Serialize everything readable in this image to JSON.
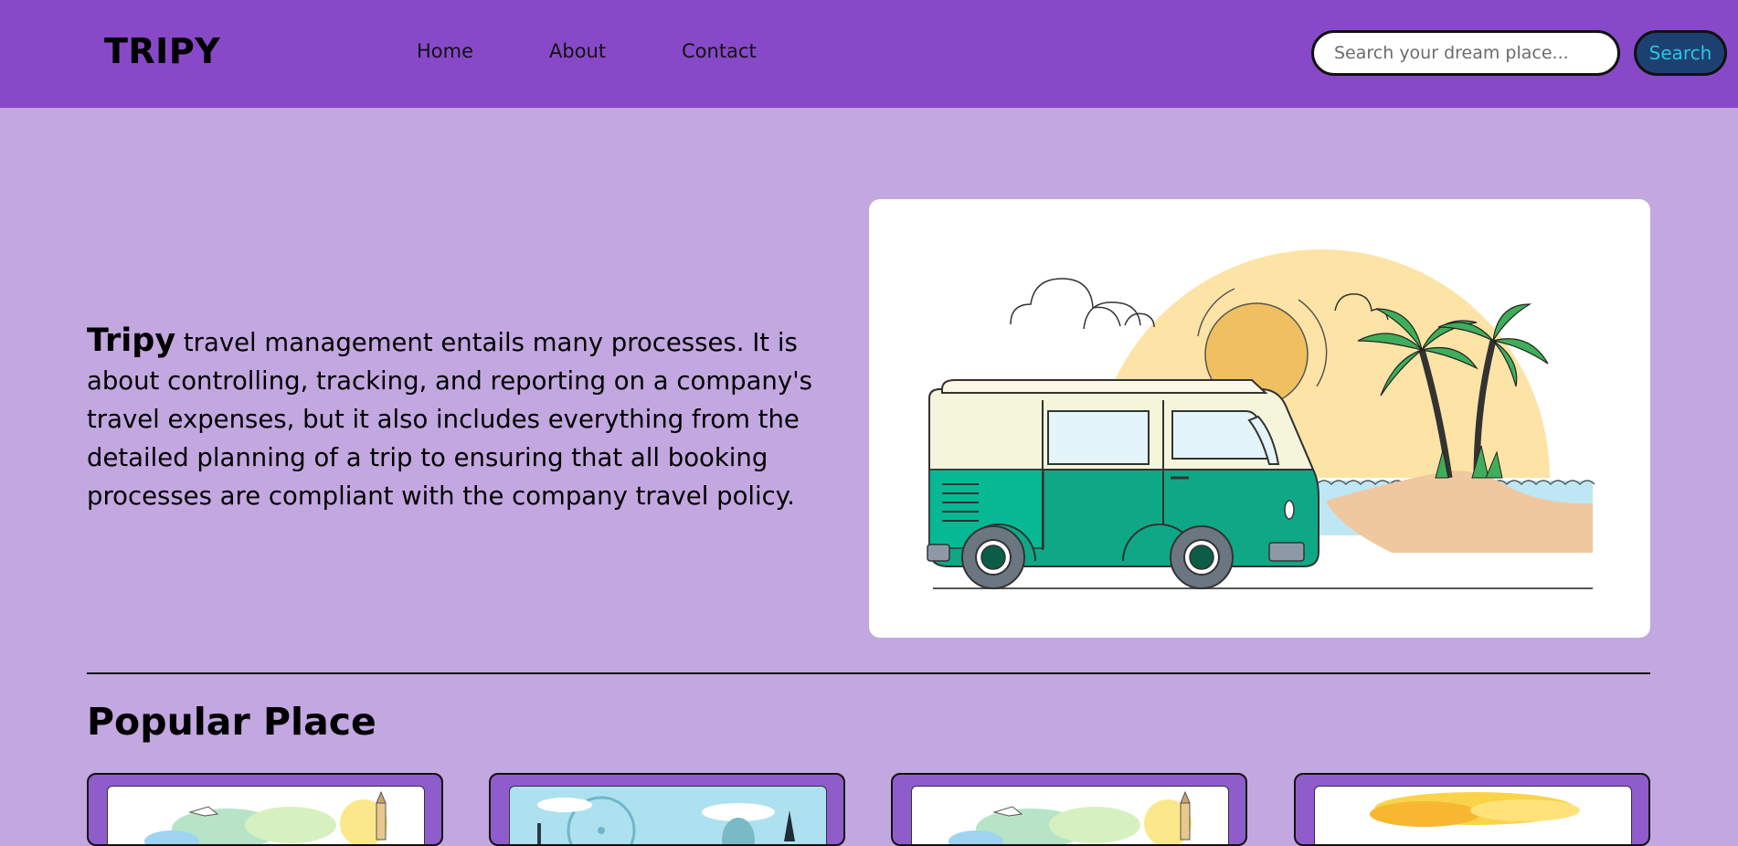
{
  "brand": "TRIPY",
  "nav": {
    "links": [
      "Home",
      "About",
      "Contact"
    ]
  },
  "search": {
    "placeholder": "Search your dream place...",
    "button_label": "Search"
  },
  "hero": {
    "brand_word": "Tripy",
    "text": " travel management entails many processes. It is about controlling, tracking, and reporting on a company's travel expenses, but it also includes everything from the detailed planning of a trip to ensuring that all booking processes are compliant with the company travel policy.",
    "illustration": "camper-van-beach-illustration"
  },
  "popular": {
    "title": "Popular Place",
    "cards": [
      {
        "image": "city-landmark-illustration"
      },
      {
        "image": "ferris-wheel-mosque-illustration"
      },
      {
        "image": "city-landmark-illustration"
      },
      {
        "image": "sunny-clouds-illustration"
      }
    ]
  },
  "colors": {
    "navbar": "#8749c8",
    "page_bg": "#c3a7e0",
    "search_button_bg": "#1c4170",
    "search_button_text": "#2bc3e6",
    "card_bg": "#8f5ccc"
  }
}
